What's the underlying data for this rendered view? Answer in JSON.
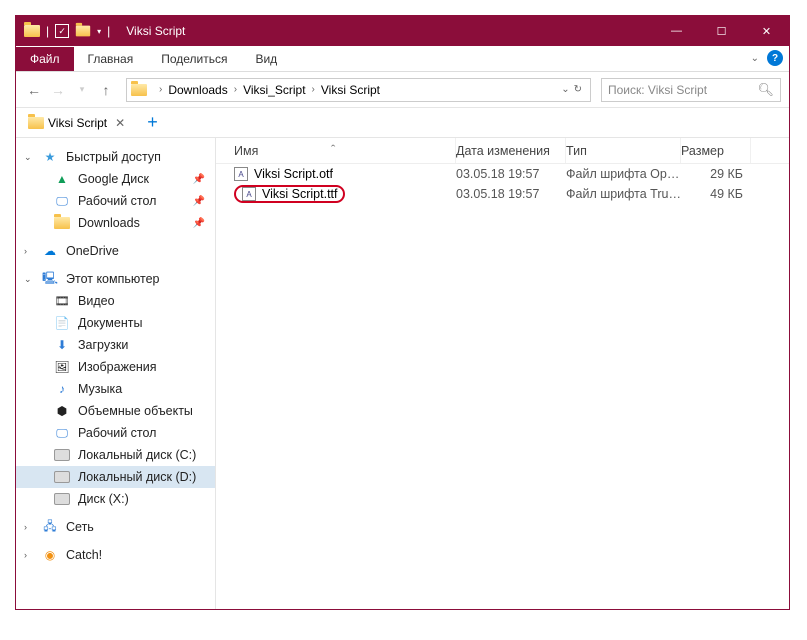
{
  "window": {
    "title": "Viksi Script"
  },
  "ribbon": {
    "file": "Файл",
    "tabs": [
      "Главная",
      "Поделиться",
      "Вид"
    ]
  },
  "breadcrumb": [
    "Downloads",
    "Viksi_Script",
    "Viksi Script"
  ],
  "search": {
    "placeholder": "Поиск: Viksi Script"
  },
  "tab": {
    "name": "Viksi Script"
  },
  "columns": {
    "name": "Имя",
    "date": "Дата изменения",
    "type": "Тип",
    "size": "Размер"
  },
  "files": [
    {
      "name": "Viksi Script.otf",
      "date": "03.05.18 19:57",
      "type": "Файл шрифта Op…",
      "size": "29 КБ"
    },
    {
      "name": "Viksi Script.ttf",
      "date": "03.05.18 19:57",
      "type": "Файл шрифта Tru…",
      "size": "49 КБ"
    }
  ],
  "sidebar": {
    "quick": "Быстрый доступ",
    "quick_items": [
      "Google Диск",
      "Рабочий стол",
      "Downloads"
    ],
    "onedrive": "OneDrive",
    "thispc": "Этот компьютер",
    "pc_items": [
      "Видео",
      "Документы",
      "Загрузки",
      "Изображения",
      "Музыка",
      "Объемные объекты",
      "Рабочий стол",
      "Локальный диск (C:)",
      "Локальный диск (D:)",
      "Диск (X:)"
    ],
    "network": "Сеть",
    "catch": "Catch!"
  }
}
